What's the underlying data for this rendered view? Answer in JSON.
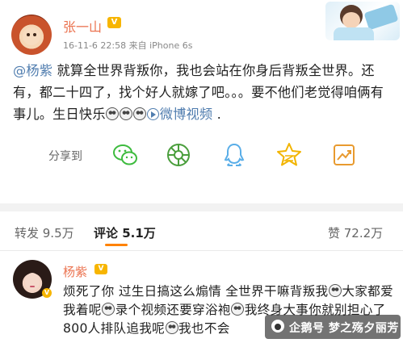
{
  "post": {
    "author": "张一山",
    "vip_badge": "V",
    "meta": "16-11-6 22:58  来自 iPhone 6s",
    "mention": "@杨紫",
    "text_1": " 就算全世界背叛你，我也会站在你身后背叛全世界。还有，都二十四了，找个好人就嫁了吧。。。要不他们老觉得咱俩有事儿。生日快乐",
    "video_link": "微博视频",
    "text_end": " ."
  },
  "share": {
    "label": "分享到",
    "targets": [
      "wechat-icon",
      "moments-icon",
      "qq-icon",
      "qzone-icon",
      "share-more-icon"
    ]
  },
  "tabs": {
    "repost": "转发 9.5万",
    "comment": "评论 5.1万",
    "like": "赞 72.2万"
  },
  "comment": {
    "author": "杨紫",
    "vip_badge": "V",
    "verified_badge": "V",
    "seg1": "烦死了你 过生日搞这么煽情 全世界干嘛背叛我",
    "seg2": "大家都爱我着呢",
    "seg3": "录个视频还要穿浴袍",
    "seg4": "我终身大事你就别担心了 800人排队追我呢",
    "seg5": "我也不会"
  },
  "watermark": {
    "text": "企鹅号 梦之殇夕丽芳"
  },
  "colors": {
    "accent": "#ff8200",
    "name": "#eb7350",
    "link": "#507daf",
    "wechat": "#3dbb3e",
    "moments": "#4a9e3c",
    "qq": "#5aaee8",
    "qzone": "#f2b400"
  }
}
